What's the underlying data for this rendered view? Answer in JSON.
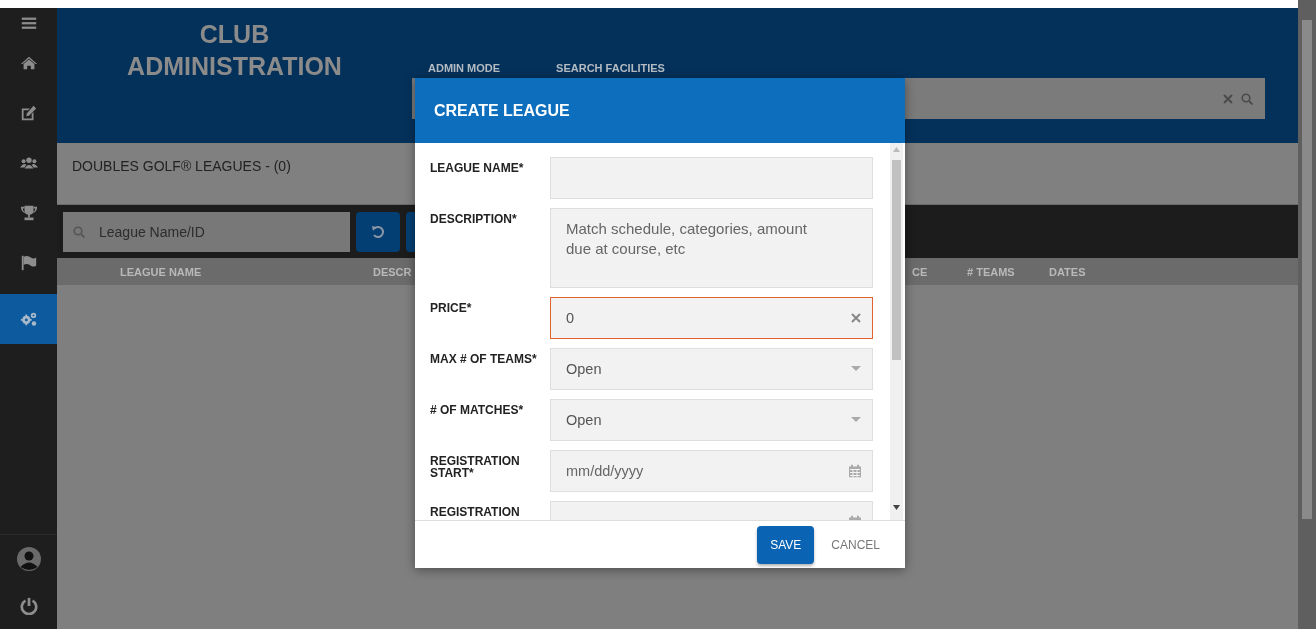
{
  "sidebar": {
    "items": [
      {
        "selected": false
      },
      {
        "selected": false
      },
      {
        "selected": false
      },
      {
        "selected": false
      },
      {
        "selected": false
      },
      {
        "selected": false
      },
      {
        "selected": true
      }
    ],
    "bottom_items": [
      {
        "kind": "avatar"
      },
      {
        "kind": "power"
      }
    ]
  },
  "header": {
    "title_lines": [
      "CLUB",
      "ADMINISTRATION"
    ],
    "nav": [
      {
        "label": "ADMIN MODE"
      },
      {
        "label": "SEARCH FACILITIES"
      }
    ]
  },
  "page": {
    "title": "DOUBLES GOLF® LEAGUES - (0)",
    "filter": {
      "placeholder": "League Name/ID"
    },
    "table": {
      "columns": [
        "LEAGUE NAME",
        "DESCR",
        "CE",
        "# TEAMS",
        "DATES"
      ]
    }
  },
  "modal": {
    "title": "CREATE LEAGUE",
    "fields": [
      {
        "kind": "text",
        "label": "LEAGUE NAME*",
        "error": false
      },
      {
        "kind": "textarea",
        "label": "DESCRIPTION*",
        "placeholder": "Match schedule, categories, amount due at course, etc",
        "error": false
      },
      {
        "kind": "text",
        "label": "PRICE*",
        "value": "0",
        "error": true
      },
      {
        "kind": "select",
        "label": "MAX # OF TEAMS*",
        "value": "Open",
        "error": false
      },
      {
        "kind": "select",
        "label": "# OF MATCHES*",
        "value": "Open",
        "error": false
      },
      {
        "kind": "date",
        "label": "REGISTRATION START*",
        "placeholder": "mm/dd/yyyy",
        "error": false
      },
      {
        "kind": "date",
        "label": "REGISTRATION",
        "error": false
      }
    ],
    "buttons": [
      {
        "label": "SAVE",
        "kind": "primary"
      },
      {
        "label": "CANCEL",
        "kind": "flat"
      }
    ]
  }
}
